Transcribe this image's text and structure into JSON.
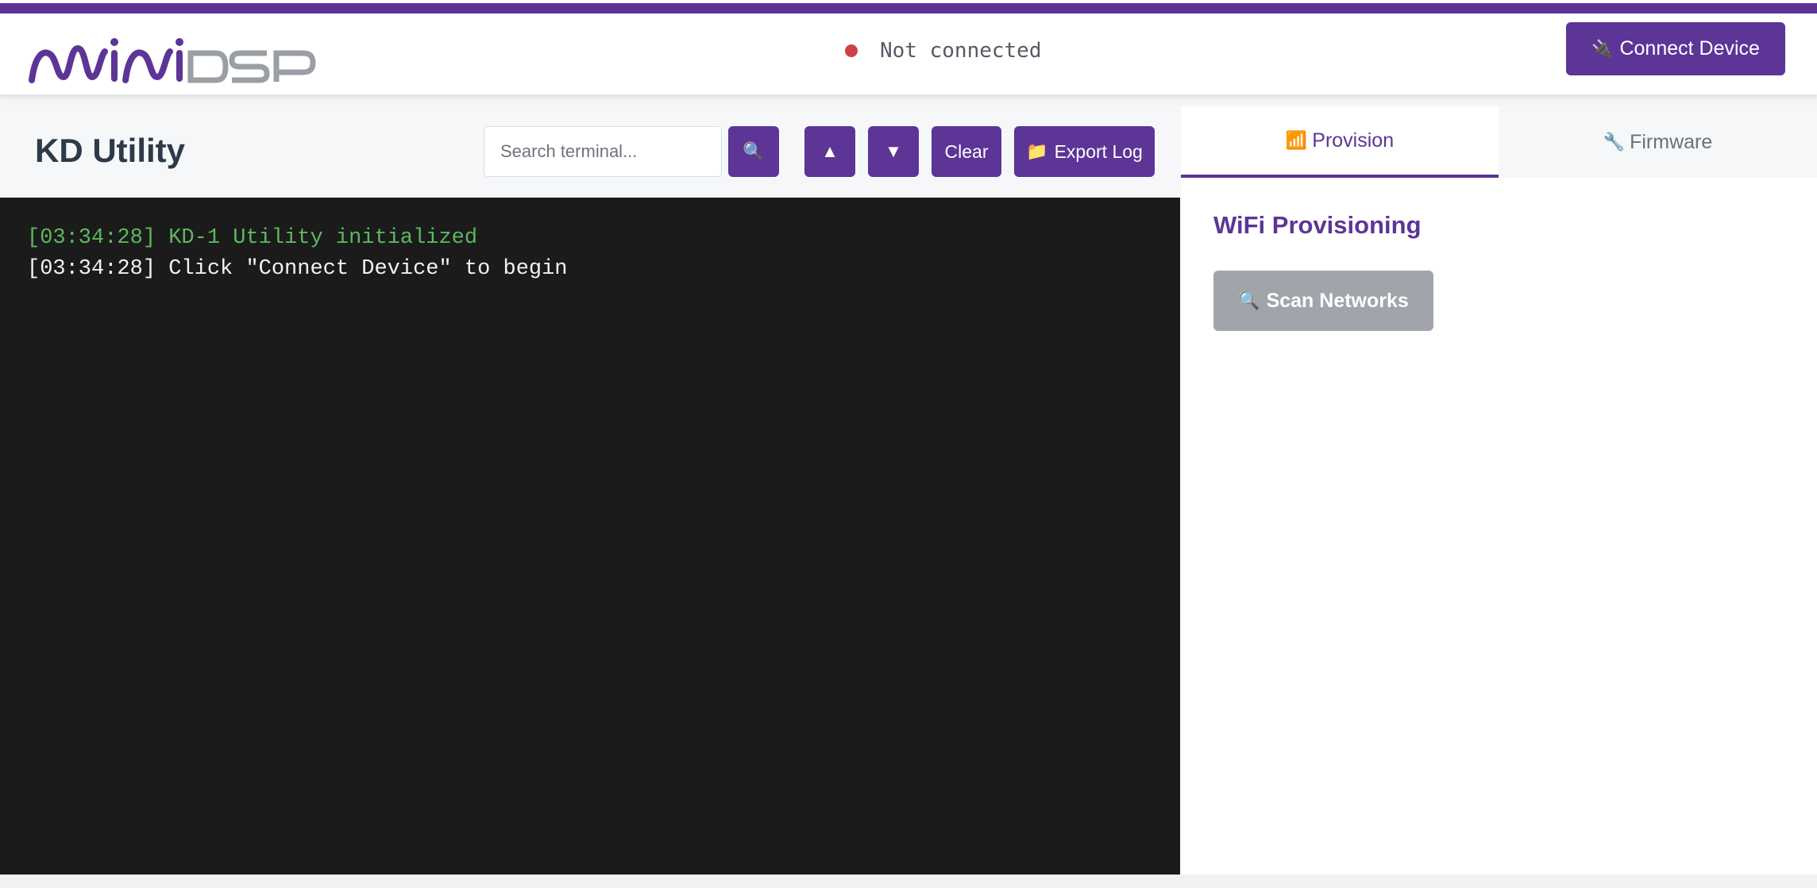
{
  "header": {
    "logo_text": "miniDSP",
    "status_text": "Not connected",
    "status_color": "#d0404a",
    "connect_button": {
      "icon": "plug-icon",
      "icon_glyph": "🔌",
      "label": "Connect Device"
    }
  },
  "toolbar": {
    "title": "KD Utility",
    "search_placeholder": "Search terminal...",
    "search_button_glyph": "🔍",
    "up_glyph": "▲",
    "down_glyph": "▼",
    "clear_label": "Clear",
    "export": {
      "icon": "folder-icon",
      "icon_glyph": "📁",
      "label": "Export Log"
    }
  },
  "terminal": {
    "lines": [
      {
        "text": "[03:34:28] KD-1 Utility initialized",
        "color": "green"
      },
      {
        "text": "[03:34:28] Click \"Connect Device\" to begin",
        "color": "white"
      }
    ]
  },
  "tabs": [
    {
      "icon": "signal-bars-icon",
      "icon_glyph": "📶",
      "label": "Provision",
      "active": true
    },
    {
      "icon": "wrench-icon",
      "icon_glyph": "🔧",
      "label": "Firmware",
      "active": false
    }
  ],
  "provision": {
    "title": "WiFi Provisioning",
    "scan_button": {
      "icon": "magnifier-icon",
      "icon_glyph": "🔍",
      "label": "Scan Networks"
    }
  },
  "colors": {
    "accent": "#5c3596",
    "terminal_bg": "#1b1b1b",
    "disabled": "#a1a5ab"
  }
}
